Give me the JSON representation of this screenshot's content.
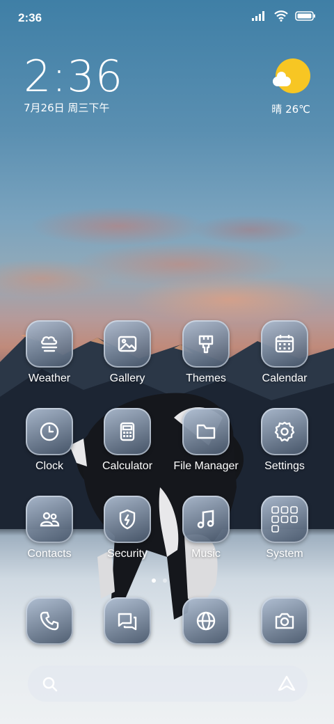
{
  "status_bar": {
    "time": "2:36"
  },
  "clock_widget": {
    "time": "2:36",
    "date": "7月26日 周三下午"
  },
  "weather_widget": {
    "condition_temp": "晴 26℃"
  },
  "apps": [
    {
      "label": "Weather",
      "icon": "weather-icon"
    },
    {
      "label": "Gallery",
      "icon": "gallery-icon"
    },
    {
      "label": "Themes",
      "icon": "themes-icon"
    },
    {
      "label": "Calendar",
      "icon": "calendar-icon"
    },
    {
      "label": "Clock",
      "icon": "clock-icon"
    },
    {
      "label": "Calculator",
      "icon": "calculator-icon"
    },
    {
      "label": "File Manager",
      "icon": "folder-icon"
    },
    {
      "label": "Settings",
      "icon": "gear-icon"
    },
    {
      "label": "Contacts",
      "icon": "contacts-icon"
    },
    {
      "label": "Security",
      "icon": "shield-icon"
    },
    {
      "label": "Music",
      "icon": "music-note-icon"
    },
    {
      "label": "System",
      "icon": "folder-grid-icon"
    }
  ],
  "dock": [
    {
      "icon": "phone-icon"
    },
    {
      "icon": "messages-icon"
    },
    {
      "icon": "browser-icon"
    },
    {
      "icon": "camera-icon"
    }
  ],
  "page_indicator": {
    "current": 1,
    "total": 2
  },
  "search": {
    "icon": "search-icon",
    "assistant_icon": "assistant-icon"
  }
}
